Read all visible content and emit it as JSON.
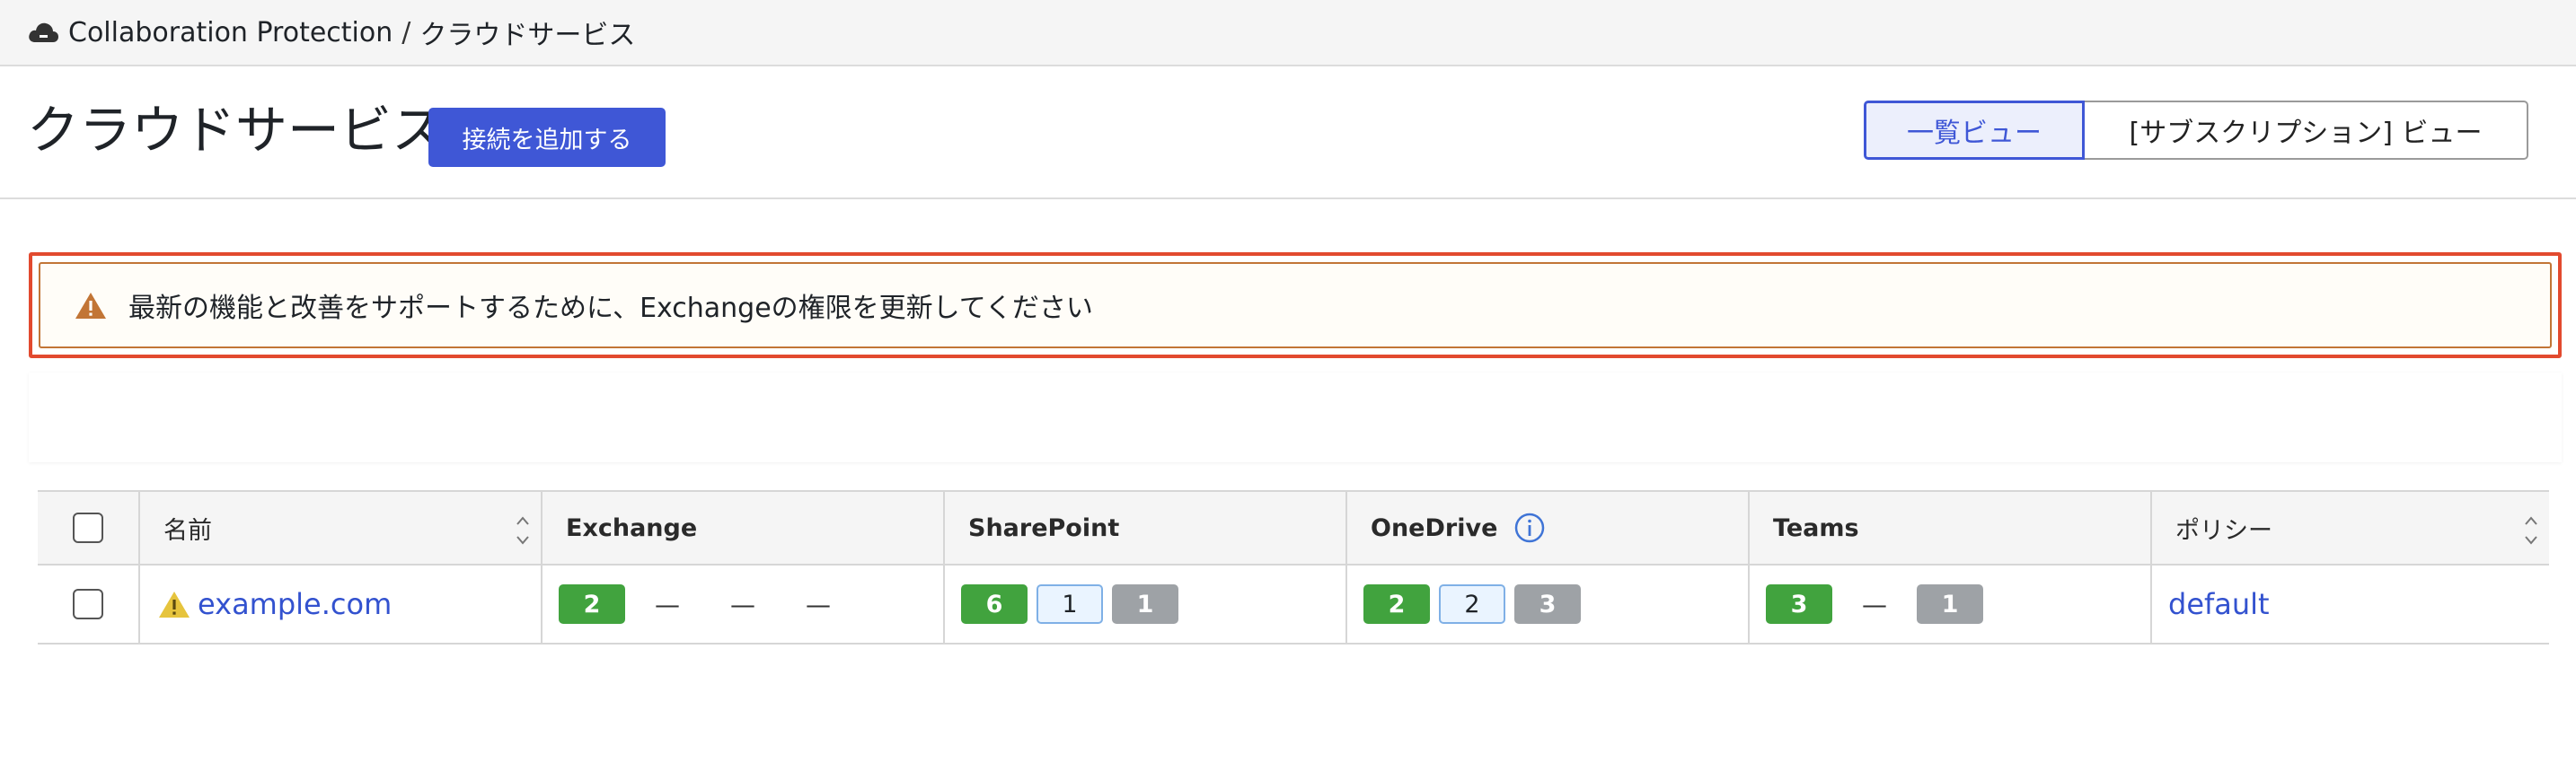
{
  "breadcrumb": {
    "root": "Collaboration Protection",
    "separator": "/",
    "current": "クラウドサービス"
  },
  "header": {
    "title": "クラウドサービス",
    "add_button": "接続を追加する",
    "view_list": "一覧ビュー",
    "view_subscription": "[サブスクリプション] ビュー"
  },
  "alert": {
    "message": "最新の機能と改善をサポートするために、Exchangeの権限を更新してください"
  },
  "table": {
    "columns": [
      "名前",
      "Exchange",
      "SharePoint",
      "OneDrive",
      "Teams",
      "ポリシー"
    ],
    "rows": [
      {
        "name": "example.com",
        "exchange": [
          "2",
          "—",
          "—",
          "—"
        ],
        "sharepoint": [
          "6",
          "1",
          "1"
        ],
        "onedrive": [
          "2",
          "2",
          "3"
        ],
        "teams": [
          "3",
          "—",
          "1"
        ],
        "policy": "default"
      }
    ]
  },
  "colors": {
    "accent": "#3f57d6",
    "alert_border": "#e24a2f",
    "warning": "#c27536",
    "badge_green": "#41a33e",
    "badge_gray": "#9ea2a6"
  },
  "icons": [
    "cloud-icon",
    "warning-icon",
    "info-icon",
    "sort-icon"
  ]
}
